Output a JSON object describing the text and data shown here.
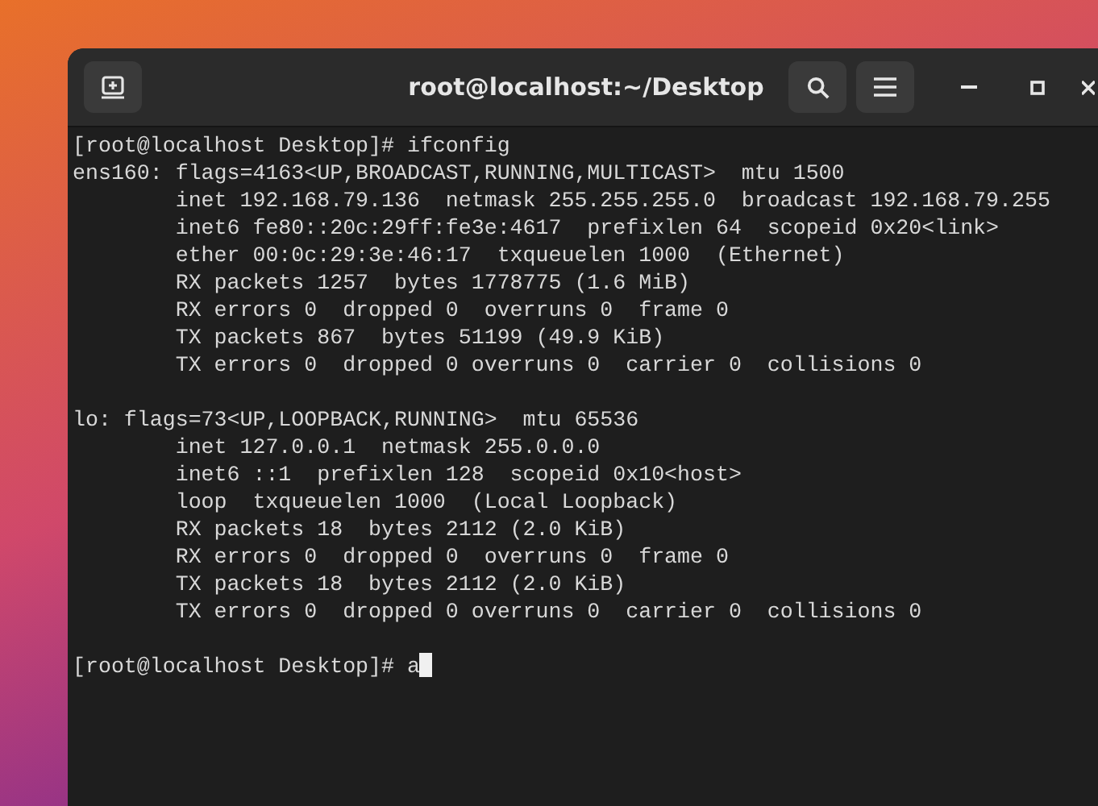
{
  "window": {
    "title": "root@localhost:~/Desktop"
  },
  "terminal": {
    "prompt": "[root@localhost Desktop]# ",
    "command": "ifconfig",
    "blocks": [
      [
        "ens160: flags=4163<UP,BROADCAST,RUNNING,MULTICAST>  mtu 1500",
        "        inet 192.168.79.136  netmask 255.255.255.0  broadcast 192.168.79.255",
        "        inet6 fe80::20c:29ff:fe3e:4617  prefixlen 64  scopeid 0x20<link>",
        "        ether 00:0c:29:3e:46:17  txqueuelen 1000  (Ethernet)",
        "        RX packets 1257  bytes 1778775 (1.6 MiB)",
        "        RX errors 0  dropped 0  overruns 0  frame 0",
        "        TX packets 867  bytes 51199 (49.9 KiB)",
        "        TX errors 0  dropped 0 overruns 0  carrier 0  collisions 0"
      ],
      [
        "lo: flags=73<UP,LOOPBACK,RUNNING>  mtu 65536",
        "        inet 127.0.0.1  netmask 255.0.0.0",
        "        inet6 ::1  prefixlen 128  scopeid 0x10<host>",
        "        loop  txqueuelen 1000  (Local Loopback)",
        "        RX packets 18  bytes 2112 (2.0 KiB)",
        "        RX errors 0  dropped 0  overruns 0  frame 0",
        "        TX packets 18  bytes 2112 (2.0 KiB)",
        "        TX errors 0  dropped 0 overruns 0  carrier 0  collisions 0"
      ]
    ],
    "final_prompt": "[root@localhost Desktop]# ",
    "input": "a"
  }
}
